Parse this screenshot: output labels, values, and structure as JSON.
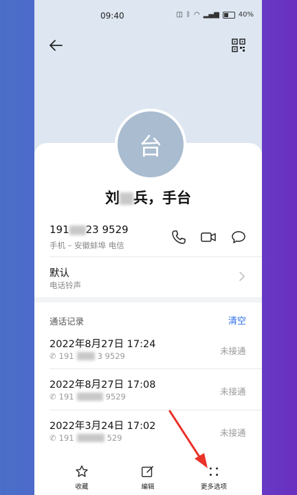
{
  "status": {
    "time": "09:40",
    "battery": "40%"
  },
  "contact": {
    "avatar_char": "台",
    "name_left": "刘",
    "name_right": "兵，手台",
    "phone_left": "191",
    "phone_right": "23 9529",
    "phone_sub": "手机 – 安徽蚌埠 电信"
  },
  "ringtone": {
    "title": "默认",
    "sub": "电话铃声"
  },
  "calllog": {
    "title": "通话记录",
    "clear": "清空",
    "entries": [
      {
        "date": "2022年8月27日 17:24",
        "num_left": "191",
        "num_right": "3 9529",
        "status": "未接通"
      },
      {
        "date": "2022年8月27日 17:08",
        "num_left": "191",
        "num_right": "9529",
        "status": "未接通"
      },
      {
        "date": "2022年3月24日 17:02",
        "num_left": "191",
        "num_right": "529",
        "status": "未接通"
      }
    ]
  },
  "tabs": {
    "favorite": "收藏",
    "edit": "编辑",
    "more": "更多选项"
  },
  "colors": {
    "accent": "#2a6ee8",
    "annotation": "#e8322a"
  }
}
